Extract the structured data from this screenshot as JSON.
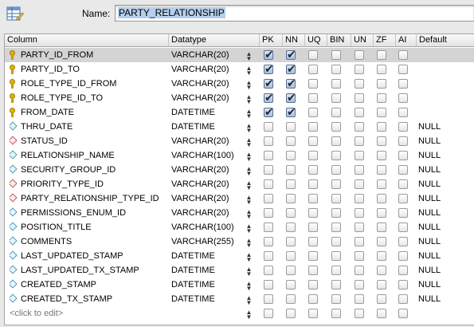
{
  "header": {
    "name_label": "Name:",
    "table_name": "PARTY_RELATIONSHIP"
  },
  "columns_header": {
    "column": "Column",
    "datatype": "Datatype",
    "pk": "PK",
    "nn": "NN",
    "uq": "UQ",
    "bin": "BIN",
    "un": "UN",
    "zf": "ZF",
    "ai": "AI",
    "default": "Default"
  },
  "rows": [
    {
      "name": "PARTY_ID_FROM",
      "type": "VARCHAR(20)",
      "icon": "key-icon",
      "pk": true,
      "nn": true,
      "default": ""
    },
    {
      "name": "PARTY_ID_TO",
      "type": "VARCHAR(20)",
      "icon": "key-icon",
      "pk": true,
      "nn": true,
      "default": ""
    },
    {
      "name": "ROLE_TYPE_ID_FROM",
      "type": "VARCHAR(20)",
      "icon": "key-icon",
      "pk": true,
      "nn": true,
      "default": ""
    },
    {
      "name": "ROLE_TYPE_ID_TO",
      "type": "VARCHAR(20)",
      "icon": "key-icon",
      "pk": true,
      "nn": true,
      "default": ""
    },
    {
      "name": "FROM_DATE",
      "type": "DATETIME",
      "icon": "key-icon",
      "pk": true,
      "nn": true,
      "default": ""
    },
    {
      "name": "THRU_DATE",
      "type": "DATETIME",
      "icon": "column-diamond-icon",
      "pk": false,
      "nn": false,
      "default": "NULL"
    },
    {
      "name": "STATUS_ID",
      "type": "VARCHAR(20)",
      "icon": "foreign-key-diamond-icon",
      "pk": false,
      "nn": false,
      "default": "NULL"
    },
    {
      "name": "RELATIONSHIP_NAME",
      "type": "VARCHAR(100)",
      "icon": "column-diamond-icon",
      "pk": false,
      "nn": false,
      "default": "NULL"
    },
    {
      "name": "SECURITY_GROUP_ID",
      "type": "VARCHAR(20)",
      "icon": "column-diamond-icon",
      "pk": false,
      "nn": false,
      "default": "NULL"
    },
    {
      "name": "PRIORITY_TYPE_ID",
      "type": "VARCHAR(20)",
      "icon": "foreign-key-diamond-icon",
      "pk": false,
      "nn": false,
      "default": "NULL"
    },
    {
      "name": "PARTY_RELATIONSHIP_TYPE_ID",
      "type": "VARCHAR(20)",
      "icon": "foreign-key-diamond-icon",
      "pk": false,
      "nn": false,
      "default": "NULL"
    },
    {
      "name": "PERMISSIONS_ENUM_ID",
      "type": "VARCHAR(20)",
      "icon": "column-diamond-icon",
      "pk": false,
      "nn": false,
      "default": "NULL"
    },
    {
      "name": "POSITION_TITLE",
      "type": "VARCHAR(100)",
      "icon": "column-diamond-icon",
      "pk": false,
      "nn": false,
      "default": "NULL"
    },
    {
      "name": "COMMENTS",
      "type": "VARCHAR(255)",
      "icon": "column-diamond-icon",
      "pk": false,
      "nn": false,
      "default": "NULL"
    },
    {
      "name": "LAST_UPDATED_STAMP",
      "type": "DATETIME",
      "icon": "column-diamond-icon",
      "pk": false,
      "nn": false,
      "default": "NULL"
    },
    {
      "name": "LAST_UPDATED_TX_STAMP",
      "type": "DATETIME",
      "icon": "column-diamond-icon",
      "pk": false,
      "nn": false,
      "default": "NULL"
    },
    {
      "name": "CREATED_STAMP",
      "type": "DATETIME",
      "icon": "column-diamond-icon",
      "pk": false,
      "nn": false,
      "default": "NULL"
    },
    {
      "name": "CREATED_TX_STAMP",
      "type": "DATETIME",
      "icon": "column-diamond-icon",
      "pk": false,
      "nn": false,
      "default": "NULL"
    }
  ],
  "placeholder_row": "<click to edit>",
  "colors": {
    "selected_row": "#d4d4d4",
    "name_highlight": "#b5d0ee"
  }
}
